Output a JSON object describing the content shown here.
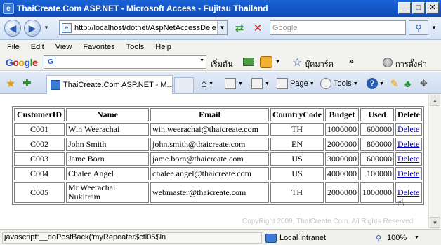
{
  "window": {
    "title": "ThaiCreate.Com ASP.NET - Microsoft Access - Fujitsu Thailand",
    "minimize": "_",
    "maximize": "□",
    "close": "✕"
  },
  "address": {
    "url": "http://localhost/dotnet/AspNetAccessDele",
    "search_placeholder": "Google"
  },
  "menu": [
    "File",
    "Edit",
    "View",
    "Favorites",
    "Tools",
    "Help"
  ],
  "google_toolbar": {
    "search_label": "เริ่มต้น",
    "bookmarks_label": "บุ๊คมาร์ค",
    "more": "»",
    "settings_label": "การตั้งค่า"
  },
  "tab": {
    "title": "ThaiCreate.Com ASP.NET - M..."
  },
  "commands": {
    "page": "Page",
    "tools": "Tools"
  },
  "table": {
    "headers": [
      "CustomerID",
      "Name",
      "Email",
      "CountryCode",
      "Budget",
      "Used",
      "Delete"
    ],
    "rows": [
      {
        "id": "C001",
        "name": "Win Weerachai",
        "email": "win.weerachai@thaicreate.com",
        "country": "TH",
        "budget": "1000000",
        "used": "600000",
        "action": "Delete"
      },
      {
        "id": "C002",
        "name": "John Smith",
        "email": "john.smith@thaicreate.com",
        "country": "EN",
        "budget": "2000000",
        "used": "800000",
        "action": "Delete"
      },
      {
        "id": "C003",
        "name": "Jame Born",
        "email": "jame.born@thaicreate.com",
        "country": "US",
        "budget": "3000000",
        "used": "600000",
        "action": "Delete"
      },
      {
        "id": "C004",
        "name": "Chalee Angel",
        "email": "chalee.angel@thaicreate.com",
        "country": "US",
        "budget": "4000000",
        "used": "100000",
        "action": "Delete"
      },
      {
        "id": "C005",
        "name": "Mr.Weerachai Nukitram",
        "email": "webmaster@thaicreate.com",
        "country": "TH",
        "budget": "2000000",
        "used": "1000000",
        "action": "Delete"
      }
    ]
  },
  "watermark": "CopyRight 2009, ThaiCreate.Com. All Rights Reserved",
  "status": {
    "text": "javascript:__doPostBack('myRepeater$ctl05$ln",
    "zone": "Local intranet",
    "zoom": "100%"
  }
}
